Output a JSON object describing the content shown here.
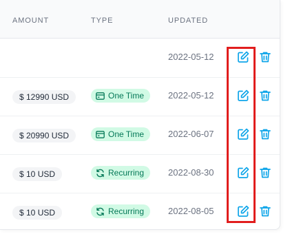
{
  "table": {
    "headers": {
      "amount": "AMOUNT",
      "type": "TYPE",
      "updated": "UPDATED"
    },
    "rows": [
      {
        "amount": "",
        "type": "",
        "type_icon": "",
        "updated": "2022-05-12"
      },
      {
        "amount": "$ 12990 USD",
        "type": "One Time",
        "type_icon": "card-icon",
        "updated": "2022-05-12"
      },
      {
        "amount": "$ 20990 USD",
        "type": "One Time",
        "type_icon": "card-icon",
        "updated": "2022-06-07"
      },
      {
        "amount": "$ 10 USD",
        "type": "Recurring",
        "type_icon": "refresh-icon",
        "updated": "2022-08-30"
      },
      {
        "amount": "$ 10 USD",
        "type": "Recurring",
        "type_icon": "refresh-icon",
        "updated": "2022-08-05"
      }
    ]
  },
  "colors": {
    "action_icon": "#0ea5e9",
    "type_badge_bg": "#d1fae5",
    "type_badge_text": "#047857",
    "highlight_border": "#e11d1d"
  },
  "icons": {
    "edit": "edit-icon",
    "delete": "trash-icon"
  }
}
